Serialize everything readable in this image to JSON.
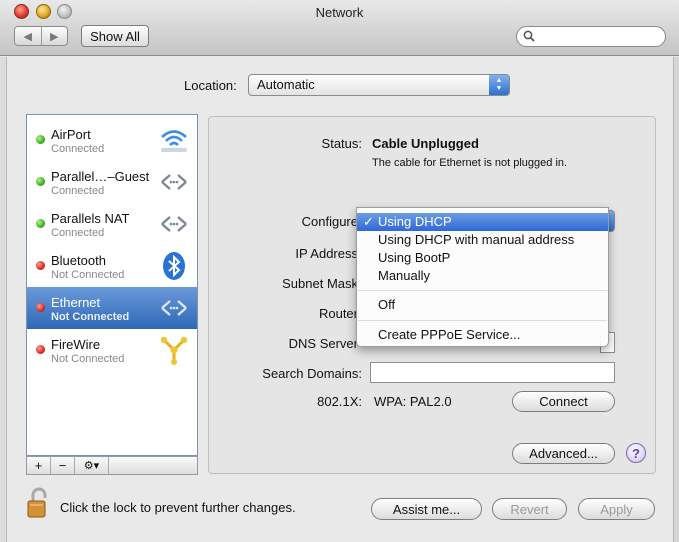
{
  "window": {
    "title": "Network"
  },
  "toolbar": {
    "back": "◀",
    "forward": "▶",
    "show_all": "Show All",
    "search_placeholder": ""
  },
  "location": {
    "label": "Location:",
    "value": "Automatic"
  },
  "services": [
    {
      "name": "AirPort",
      "status": "Connected",
      "dot": "green",
      "icon": "wifi-icon"
    },
    {
      "name": "Parallel…–Guest",
      "status": "Connected",
      "dot": "green",
      "icon": "ethernet-arrows-icon"
    },
    {
      "name": "Parallels NAT",
      "status": "Connected",
      "dot": "green",
      "icon": "ethernet-arrows-icon"
    },
    {
      "name": "Bluetooth",
      "status": "Not Connected",
      "dot": "red",
      "icon": "bluetooth-icon"
    },
    {
      "name": "Ethernet",
      "status": "Not Connected",
      "dot": "red",
      "icon": "ethernet-arrows-icon"
    },
    {
      "name": "FireWire",
      "status": "Not Connected",
      "dot": "red",
      "icon": "firewire-icon"
    }
  ],
  "sidebar_buttons": {
    "add": "+",
    "remove": "−",
    "gear": "⚙▾"
  },
  "detail": {
    "status_label": "Status:",
    "status_value": "Cable Unplugged",
    "status_desc": "The cable for Ethernet is not plugged in.",
    "configure_label": "Configure",
    "ip_label": "IP Address",
    "subnet_label": "Subnet Mask",
    "router_label": "Router",
    "dns_label": "DNS Server",
    "search_domains_label": "Search Domains:",
    "dot1x_label": "802.1X:",
    "dot1x_value": "WPA: PAL2.0",
    "connect_button": "Connect",
    "advanced_button": "Advanced...",
    "help": "?"
  },
  "configure_menu": {
    "items": [
      "Using DHCP",
      "Using DHCP with manual address",
      "Using BootP",
      "Manually",
      "Off",
      "Create PPPoE Service..."
    ],
    "checkmark": "✓"
  },
  "footer": {
    "lock_text": "Click the lock to prevent further changes.",
    "assist": "Assist me...",
    "revert": "Revert",
    "apply": "Apply"
  }
}
